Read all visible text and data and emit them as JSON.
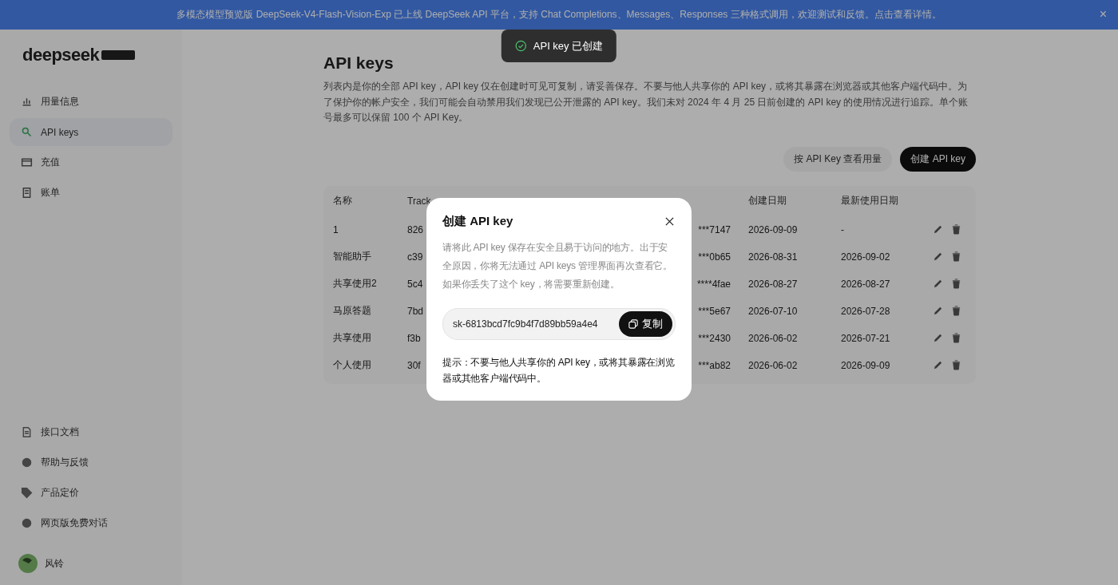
{
  "banner": {
    "text": "多模态模型预览版 DeepSeek-V4-Flash-Vision-Exp 已上线 DeepSeek API 平台，支持 Chat Completions、Messages、Responses 三种格式调用，欢迎测试和反馈。点击查看详情。",
    "close": "×"
  },
  "toast": {
    "text": "API key 已创建"
  },
  "sidebar": {
    "logo": "deepseek",
    "items": [
      {
        "label": "用量信息",
        "selected": false
      },
      {
        "label": "API keys",
        "selected": true
      },
      {
        "label": "充值",
        "selected": false
      },
      {
        "label": "账单",
        "selected": false
      }
    ],
    "bottom_items": [
      {
        "label": "接口文档"
      },
      {
        "label": "帮助与反馈"
      },
      {
        "label": "产品定价"
      },
      {
        "label": "网页版免费对话"
      }
    ],
    "user": {
      "name": "风铃"
    }
  },
  "page": {
    "title": "API keys",
    "description": "列表内是你的全部 API key，API key 仅在创建时可见可复制，请妥善保存。不要与他人共享你的 API key，或将其暴露在浏览器或其他客户端代码中。为了保护你的帐户安全，我们可能会自动禁用我们发现已公开泄露的 API key。我们未对 2024 年 4 月 25 日前创建的 API key 的使用情况进行追踪。单个账号最多可以保留 100 个 API Key。",
    "buttons": [
      {
        "label": "按 API Key 查看用量",
        "kind": "secondary"
      },
      {
        "label": "创建 API key",
        "kind": "primary"
      }
    ]
  },
  "table": {
    "columns": [
      "名称",
      "Track",
      "",
      "创建日期",
      "最新使用日期"
    ],
    "rows": [
      {
        "name": "1",
        "tracking": "826",
        "key": "***7147",
        "created": "2026-09-09",
        "last_used": "-"
      },
      {
        "name": "智能助手",
        "tracking": "c39",
        "key": "***0b65",
        "created": "2026-08-31",
        "last_used": "2026-09-02"
      },
      {
        "name": "共享使用2",
        "tracking": "5c4",
        "key": "****4fae",
        "created": "2026-08-27",
        "last_used": "2026-08-27"
      },
      {
        "name": "马原答题",
        "tracking": "7bd",
        "key": "***5e67",
        "created": "2026-07-10",
        "last_used": "2026-07-28"
      },
      {
        "name": "共享使用",
        "tracking": "f3b",
        "key": "***2430",
        "created": "2026-06-02",
        "last_used": "2026-07-21"
      },
      {
        "name": "个人使用",
        "tracking": "30f",
        "key": "***ab82",
        "created": "2026-06-02",
        "last_used": "2026-09-09"
      }
    ]
  },
  "dialog": {
    "title": "创建 API key",
    "description": "请将此 API key 保存在安全且易于访问的地方。出于安全原因，你将无法通过 API keys 管理界面再次查看它。如果你丢失了这个 key，将需要重新创建。",
    "key_value": "sk-6813bcd7fc9b4f7d89bb59a4e4",
    "copy": "复制",
    "hint": "提示：不要与他人共享你的 API key，或将其暴露在浏览器或其他客户端代码中。"
  }
}
